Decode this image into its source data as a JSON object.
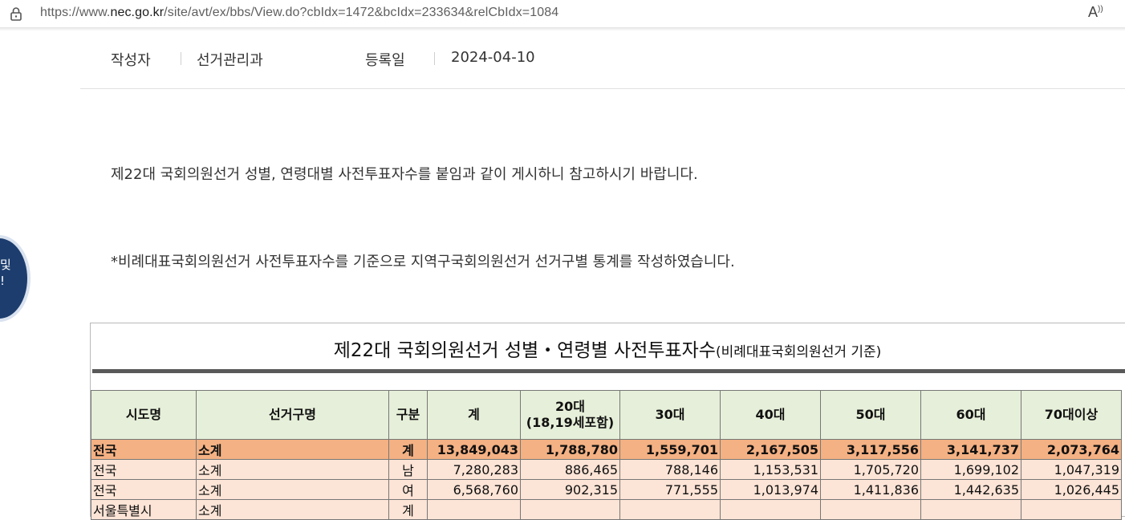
{
  "browser": {
    "url_prefix": "https://www.",
    "url_host": "nec.go.kr",
    "url_path": "/site/avt/ex/bbs/View.do?cbIdx=1472&bcIdx=233634&relCbIdx=1084",
    "reader_label": "A",
    "reader_sup": "))"
  },
  "meta": {
    "author_label": "작성자",
    "author_value": "선거관리과",
    "date_label": "등록일",
    "date_value": "2024-04-10"
  },
  "body": {
    "paragraph1": "제22대 국회의원선거 성별, 연령대별 사전투표자수를 붙임과 같이 게시하니 참고하시기 바랍니다.",
    "paragraph2": "*비례대표국회의원선거 사전투표자수를 기준으로 지역구국회의원선거 선거구별 통계를 작성하였습니다."
  },
  "badge": {
    "line1": "및",
    "line2": "!"
  },
  "table": {
    "title": "제22대 국회의원선거 성별・연령별 사전투표자수",
    "subtitle": "(비례대표국회의원선거 기준)",
    "headers": {
      "region": "시도명",
      "district": "선거구명",
      "category": "구분",
      "total": "계",
      "age20_line1": "20대",
      "age20_line2": "(18,19세포함)",
      "age30": "30대",
      "age40": "40대",
      "age50": "50대",
      "age60": "60대",
      "age70": "70대이상"
    },
    "rows": [
      {
        "region": "전국",
        "district": "소계",
        "category": "계",
        "total": "13,849,043",
        "age20": "1,788,780",
        "age30": "1,559,701",
        "age40": "2,167,505",
        "age50": "3,117,556",
        "age60": "3,141,737",
        "age70": "2,073,764"
      },
      {
        "region": "전국",
        "district": "소계",
        "category": "남",
        "total": "7,280,283",
        "age20": "886,465",
        "age30": "788,146",
        "age40": "1,153,531",
        "age50": "1,705,720",
        "age60": "1,699,102",
        "age70": "1,047,319"
      },
      {
        "region": "전국",
        "district": "소계",
        "category": "여",
        "total": "6,568,760",
        "age20": "902,315",
        "age30": "771,555",
        "age40": "1,013,974",
        "age50": "1,411,836",
        "age60": "1,442,635",
        "age70": "1,026,445"
      },
      {
        "region": "서울특별시",
        "district": "소계",
        "category": "계",
        "total": "",
        "age20": "",
        "age30": "",
        "age40": "",
        "age50": "",
        "age60": "",
        "age70": ""
      }
    ]
  },
  "colors": {
    "header_bg": "#e6efd9",
    "total_row_bg": "#f4b183",
    "row_bg": "#fce4d6",
    "badge_bg": "#1c3d6e"
  }
}
